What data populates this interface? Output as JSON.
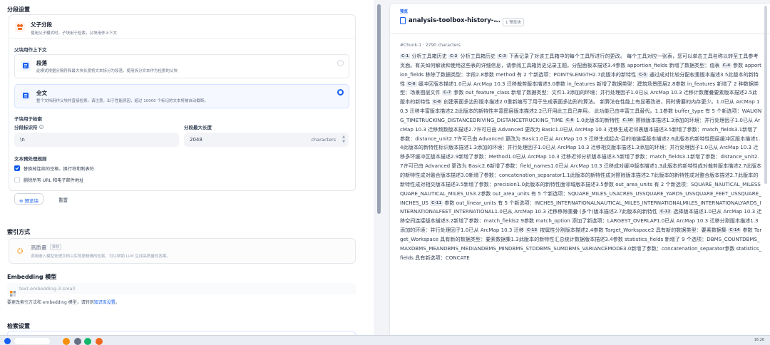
{
  "left": {
    "section_chunking": "分段设置",
    "parent_child": {
      "title": "父子分段",
      "desc": "使用父子模式时，子块用于检索，父块用作上下文"
    },
    "parent_ctx_label": "父块用作上下文",
    "paragraph": {
      "title": "段落",
      "desc": "此模式根据分隔符和最大块长度将文本拆分为段落，使用拆分文本作为检索的父块"
    },
    "fulltext": {
      "title": "全文",
      "desc": "整个文档用作父块并直接检索。请注意，出于性能原因，超过 10000 个标记的文本将被自动截断。"
    },
    "child_label": "子块用于检索",
    "separator_label": "分段标识符",
    "separator_value": "\\n",
    "maxlen_label": "分段最大长度",
    "maxlen_value": "2048",
    "maxlen_unit": "characters",
    "preprocess_label": "文本预处理规则",
    "rule1": "替换掉连续的空格、换行符和制表符",
    "rule2": "删除所有 URL 和电子邮件地址",
    "preview_btn": "预览块",
    "reset_btn": "重置",
    "index_label": "索引方式",
    "hq": {
      "title": "高质量",
      "badge": "推荐",
      "desc": "调用嵌入模型处理文档以实现更精确的检索，可以帮助 LLM 生成高质量的答案。"
    },
    "embedding_label": "Embedding 模型",
    "embedding_model": "text-embedding-3-small",
    "embedding_note_prefix": "要更改索引方法和 embedding 模型，请转到",
    "embedding_note_link": "知识库设置",
    "embedding_note_suffix": "。",
    "retrieval_label": "检索设置"
  },
  "right": {
    "preview_tag": "预览",
    "doc_title": "analysis-toolbox-history-...",
    "badge": "1 预览块",
    "meta_chunk": "Chunk-1",
    "meta_chars": "2790 characters",
    "chunks": [
      {
        "tag": "C-1",
        "text": "分析工具箱历史"
      },
      {
        "tag": "C-2",
        "text": "分析工具箱历史"
      },
      {
        "tag": "C-3",
        "text": "下表记录了对该工具箱中的每个工具所进行的更改。 每个工具对应一张表，您可以单击工具名称以转至工具参考页面。有关如何解读和使用这些表的详细信息，请参阅工具箱历史记录主题。分配面板本描述3.4参数 apportion_fields 新增了数据类型：值表"
      },
      {
        "tag": "C-4",
        "text": "参数 apportion_fields 移除了数据类型：字段2.8参数 method 有 2 个新选项：POINTSLENGTH2.7此版本的新特性"
      },
      {
        "tag": "C-5",
        "text": "通过成对比较分配权重版本描述3.5此版本的新特性"
      },
      {
        "tag": "C-6",
        "text": "缓冲区版本描述1.0已从 ArcMap 10.3 迁移裁剪版本描述3.0参数 in_features 新增了数据类型：建筑场景图层2.8参数 in_features 新增了 2 种数据类型：场景图层文件"
      },
      {
        "tag": "C-7",
        "text": "参数 out_feature_class 新增了数据类型：文件1.3添加的环境：并行处理因子1.0已从 ArcMap 10.3 迁移计数覆叠要素版本描述2.5此版本的新特性"
      },
      {
        "tag": "C-8",
        "text": "创建表面多边形版本描述2.0重新编写了用于生成表面多边形的算法。 新算法在性能上有显著改进，同时需要的内存更少。1.0已从 ArcMap 10.3 迁移丰富版本描述2.2此版本的新特性丰富图层版本描述2.2已开用此工具已弃用。 此功能已由丰富工具替代。1.1参数 buffer_type 有 5 个新选项：WALKING_TIMETRUCKING_DISTANCEDRIVING_DISTANCETRUCKING_TIME"
      },
      {
        "tag": "C-9",
        "text": "1.0此版本的新特性"
      },
      {
        "tag": "C-10",
        "text": "擦除版本描述1.3添加的环境：并行处理因子1.0已从 ArcMap 10.3 迁移频数版本描述2.7许可已由 Advanced 更改为 Basic1.0已从 ArcMap 10.3 迁移生成近邻表版本描述3.5新增了参数：match_fields3.1新增了参数：distance_unit2.7许可已由 Advanced 更改为 Basic1.0已从 ArcMap 10.3 迁移生成起点-目的地链接版本描述2.6此版本的新特性图层缓冲区版本描述1.4此版本的新特性标识版本描述1.3添加的环境：并行处理因子1.0已从 ArcMap 10.3 迁移相交版本描述1.3添加的环境：并行处理因子1.0已从 ArcMap 10.3 迁移多环缓冲区版本描述2.9新增了参数：Method1.0已从 ArcMap 10.3 迁移近邻分析版本描述3.5新增了参数：match_fields3.1新增了参数：distance_unit2.7许可已由 Advanced 更改为 Basic2.6新增了参数：field_names1.0已从 ArcMap 10.3 迁移成对缓冲版本描述1.3此版本的新特性成对裁剪版本描述2.7此版本的新特性成对融合版本描述3.0新增了参数：concatenation_separator1.1此版本的新特性成对擦除版本描述2.7此版本的新特性成对整合版本描述2.7此版本的新特性成对相交版本描述3.5新增了参数：precision1.0此版本的新特性面邻域版本描述3.5参数 out_area_units 有 2 个新选项：SQUARE_NAUTICAL_MILESSQUARE_NAUTICAL_MILES_US3.2参数 out_area_units 有 5 个新选项：SQUARE_MILES_USACRES_USSQUARE_YARDS_USSQUARE_FEET_USSQUARE_INCHES_US"
      },
      {
        "tag": "C-11",
        "text": "参数 out_linear_units 有 5 个新选项：INCHES_INTERNATIONALNAUTICAL_MILES_INTERNATIONALMILES_INTERNATIONALYARDS_INTERNATIONALFEET_INTERNATIONAL1.0已从 ArcMap 10.3 迁移移除重叠 (多个)版本描述2.7此版本的新特性"
      },
      {
        "tag": "C-12",
        "text": "选择版本描述1.0已从 ArcMap 10.3 迁移空间连接版本描述3.2新增了参数：match_fields2.9参数 match_option 添加了新选项：LARGEST_OVERLAP1.0已从 ArcMap 10.3 迁移分割版本描述1.3添加的环境：并行处理因子1.0已从 ArcMap 10.3 迁移"
      },
      {
        "tag": "C-13",
        "text": "按属性分割版本描述2.4参数 Target_Workspace2 具有新的数据类型：要素数据集"
      },
      {
        "tag": "C-14",
        "text": "参数 Target_Workspace 具有新的数据类型：要素数据集1.3此版本的新特性汇总统计数据版本描述3.4参数 statistics_fields 新增了 9 个选项：DBMS_COUNTDBMS_MAXDBMS_MEANDBMS_MEDIANDBMS_MINDBMS_STDDBMS_SUMDBMS_VARIANCEMODE3.0新增了参数：concatenation_separator参数 statistics_fields 具有新选项：CONCATE"
      }
    ]
  },
  "taskbar": {
    "time": "16:26"
  },
  "colors": {
    "accent": "#155eef",
    "orange": "#ef6820"
  }
}
